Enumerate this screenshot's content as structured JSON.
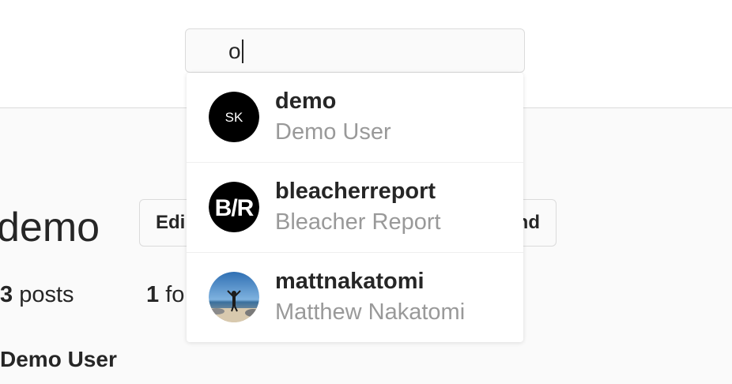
{
  "search": {
    "value": "o"
  },
  "profile": {
    "username": "demo",
    "edit_label_left": "Edi",
    "edit_label_right": "nd",
    "posts_count": "3",
    "posts_label": "posts",
    "followers_count": "1",
    "followers_label": "fo",
    "full_name": "Demo User"
  },
  "results": [
    {
      "username": "demo",
      "full_name": "Demo User",
      "avatar": "sk-monogram-icon",
      "avatar_text": "SK"
    },
    {
      "username": "bleacherreport",
      "full_name": "Bleacher Report",
      "avatar": "br-logo-icon",
      "avatar_text": "B/R"
    },
    {
      "username": "mattnakatomi",
      "full_name": "Matthew Nakatomi",
      "avatar": "beach-photo-avatar"
    }
  ],
  "colors": {
    "primary_text": "#262626",
    "secondary_text": "#999999",
    "border": "#dbdbdb",
    "background": "#fafafa"
  }
}
